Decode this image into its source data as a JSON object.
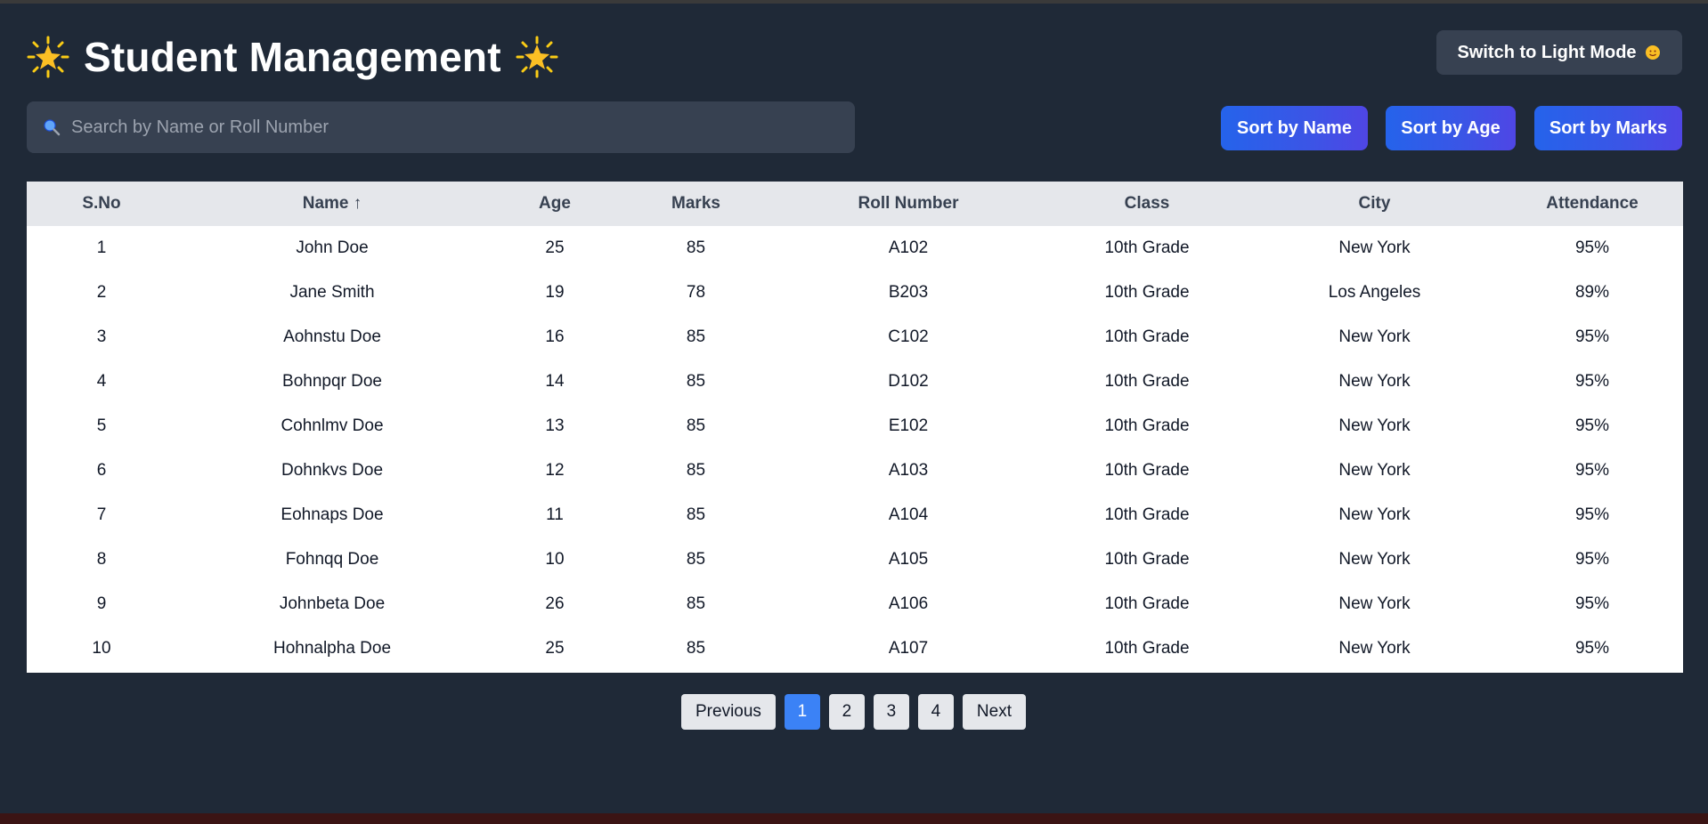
{
  "header": {
    "title": "Student Management",
    "mode_button": "Switch to Light Mode"
  },
  "search": {
    "placeholder": "Search by Name or Roll Number",
    "value": ""
  },
  "sort_buttons": {
    "name": "Sort by Name",
    "age": "Sort by Age",
    "marks": "Sort by Marks"
  },
  "table": {
    "columns": [
      "S.No",
      "Name ↑",
      "Age",
      "Marks",
      "Roll Number",
      "Class",
      "City",
      "Attendance"
    ],
    "rows": [
      [
        "1",
        "John Doe",
        "25",
        "85",
        "A102",
        "10th Grade",
        "New York",
        "95%"
      ],
      [
        "2",
        "Jane Smith",
        "19",
        "78",
        "B203",
        "10th Grade",
        "Los Angeles",
        "89%"
      ],
      [
        "3",
        "Aohnstu Doe",
        "16",
        "85",
        "C102",
        "10th Grade",
        "New York",
        "95%"
      ],
      [
        "4",
        "Bohnpqr Doe",
        "14",
        "85",
        "D102",
        "10th Grade",
        "New York",
        "95%"
      ],
      [
        "5",
        "Cohnlmv Doe",
        "13",
        "85",
        "E102",
        "10th Grade",
        "New York",
        "95%"
      ],
      [
        "6",
        "Dohnkvs Doe",
        "12",
        "85",
        "A103",
        "10th Grade",
        "New York",
        "95%"
      ],
      [
        "7",
        "Eohnaps Doe",
        "11",
        "85",
        "A104",
        "10th Grade",
        "New York",
        "95%"
      ],
      [
        "8",
        "Fohnqq Doe",
        "10",
        "85",
        "A105",
        "10th Grade",
        "New York",
        "95%"
      ],
      [
        "9",
        "Johnbeta Doe",
        "26",
        "85",
        "A106",
        "10th Grade",
        "New York",
        "95%"
      ],
      [
        "10",
        "Hohnalpha Doe",
        "25",
        "85",
        "A107",
        "10th Grade",
        "New York",
        "95%"
      ]
    ]
  },
  "pagination": {
    "previous": "Previous",
    "pages": [
      "1",
      "2",
      "3",
      "4"
    ],
    "current": "1",
    "next": "Next"
  },
  "icons": {
    "title_left": "glowing-star-icon",
    "title_right": "glowing-star-icon",
    "mode": "sun-with-face-icon",
    "search": "magnifying-glass-icon"
  },
  "colors": {
    "background": "#1f2937",
    "accent": "#2563eb",
    "active_page": "#3b82f6"
  }
}
